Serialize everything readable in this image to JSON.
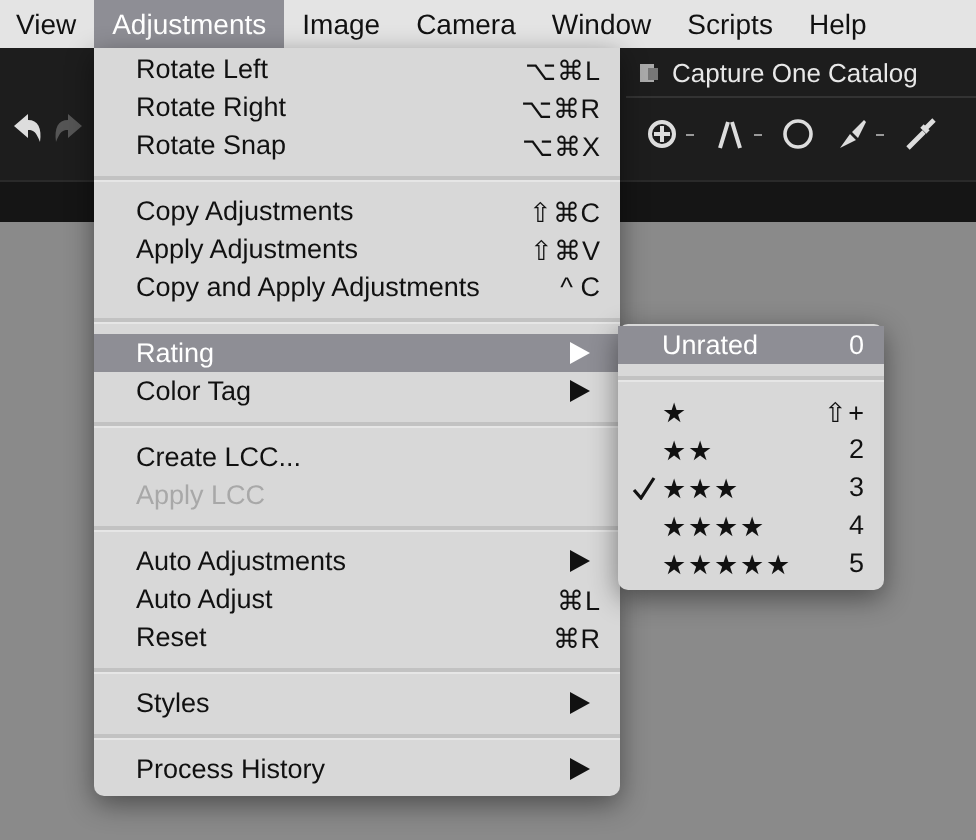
{
  "menubar": [
    {
      "label": "View",
      "selected": false
    },
    {
      "label": "Adjustments",
      "selected": true
    },
    {
      "label": "Image",
      "selected": false
    },
    {
      "label": "Camera",
      "selected": false
    },
    {
      "label": "Window",
      "selected": false
    },
    {
      "label": "Scripts",
      "selected": false
    },
    {
      "label": "Help",
      "selected": false
    }
  ],
  "toolbar": {
    "catalog_title": "Capture One Catalog"
  },
  "menu": {
    "items": [
      {
        "kind": "item",
        "label": "Rotate Left",
        "shortcut": "⌥⌘L",
        "selected": false,
        "disabled": false,
        "submenu": false
      },
      {
        "kind": "item",
        "label": "Rotate Right",
        "shortcut": "⌥⌘R",
        "selected": false,
        "disabled": false,
        "submenu": false
      },
      {
        "kind": "item",
        "label": "Rotate Snap",
        "shortcut": "⌥⌘X",
        "selected": false,
        "disabled": false,
        "submenu": false
      },
      {
        "kind": "separator"
      },
      {
        "kind": "item",
        "label": "Copy Adjustments",
        "shortcut": "⇧⌘C",
        "selected": false,
        "disabled": false,
        "submenu": false
      },
      {
        "kind": "item",
        "label": "Apply Adjustments",
        "shortcut": "⇧⌘V",
        "selected": false,
        "disabled": false,
        "submenu": false
      },
      {
        "kind": "item",
        "label": "Copy and Apply Adjustments",
        "shortcut": "^ C",
        "selected": false,
        "disabled": false,
        "submenu": false
      },
      {
        "kind": "separator"
      },
      {
        "kind": "item",
        "label": "Rating",
        "selected": true,
        "disabled": false,
        "submenu": true
      },
      {
        "kind": "item",
        "label": "Color Tag",
        "selected": false,
        "disabled": false,
        "submenu": true
      },
      {
        "kind": "separator"
      },
      {
        "kind": "item",
        "label": "Create LCC...",
        "selected": false,
        "disabled": false,
        "submenu": false
      },
      {
        "kind": "item",
        "label": "Apply LCC",
        "selected": false,
        "disabled": true,
        "submenu": false
      },
      {
        "kind": "separator"
      },
      {
        "kind": "item",
        "label": "Auto Adjustments",
        "selected": false,
        "disabled": false,
        "submenu": true
      },
      {
        "kind": "item",
        "label": "Auto Adjust",
        "shortcut": "⌘L",
        "selected": false,
        "disabled": false,
        "submenu": false
      },
      {
        "kind": "item",
        "label": "Reset",
        "shortcut": "⌘R",
        "selected": false,
        "disabled": false,
        "submenu": false
      },
      {
        "kind": "separator"
      },
      {
        "kind": "item",
        "label": "Styles",
        "selected": false,
        "disabled": false,
        "submenu": true
      },
      {
        "kind": "separator"
      },
      {
        "kind": "item",
        "label": "Process History",
        "selected": false,
        "disabled": false,
        "submenu": true
      }
    ]
  },
  "submenu": {
    "items": [
      {
        "kind": "item",
        "label": "Unrated",
        "shortcut": "0",
        "selected": true,
        "checked": false
      },
      {
        "kind": "separator"
      },
      {
        "kind": "item",
        "label": "★",
        "shortcut": "⇧+",
        "selected": false,
        "checked": false
      },
      {
        "kind": "item",
        "label": "★★",
        "shortcut": "2",
        "selected": false,
        "checked": false
      },
      {
        "kind": "item",
        "label": "★★★",
        "shortcut": "3",
        "selected": false,
        "checked": true
      },
      {
        "kind": "item",
        "label": "★★★★",
        "shortcut": "4",
        "selected": false,
        "checked": false
      },
      {
        "kind": "item",
        "label": "★★★★★",
        "shortcut": "5",
        "selected": false,
        "checked": false
      }
    ]
  }
}
